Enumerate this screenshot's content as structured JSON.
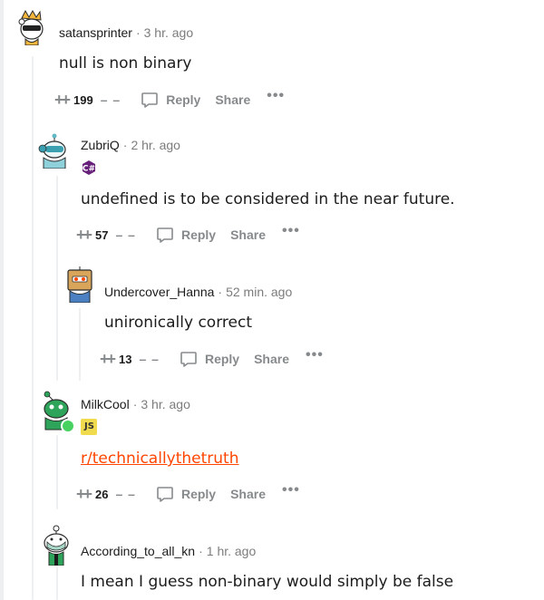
{
  "comments": [
    {
      "author": "satansprinter",
      "time": "3 hr. ago",
      "body": "null is non binary",
      "score": "199",
      "reply_label": "Reply",
      "share_label": "Share",
      "more_label": "•••"
    },
    {
      "author": "ZubriQ",
      "time": "2 hr. ago",
      "flair": "C#",
      "flair_color": "#68217a",
      "body": "undefined is to be considered in the near future.",
      "score": "57",
      "reply_label": "Reply",
      "share_label": "Share",
      "more_label": "•••"
    },
    {
      "author": "Undercover_Hanna",
      "time": "52 min. ago",
      "body": "unironically correct",
      "score": "13",
      "reply_label": "Reply",
      "share_label": "Share",
      "more_label": "•••"
    },
    {
      "author": "MilkCool",
      "time": "3 hr. ago",
      "flair": "JS",
      "flair_color": "#f0db4f",
      "body": "r/technicallythetruth",
      "score": "26",
      "reply_label": "Reply",
      "share_label": "Share",
      "more_label": "•••"
    },
    {
      "author": "According_to_all_kn",
      "time": "1 hr. ago",
      "body": "I mean I guess non-binary would simply be false"
    }
  ],
  "colors": {
    "link": "#ff4500",
    "muted": "#878a8c",
    "thread_line": "#edeff1",
    "online": "#46d160"
  },
  "icons": [
    "upvote-icon",
    "downvote-icon",
    "reply-bubble-icon",
    "more-icon"
  ]
}
